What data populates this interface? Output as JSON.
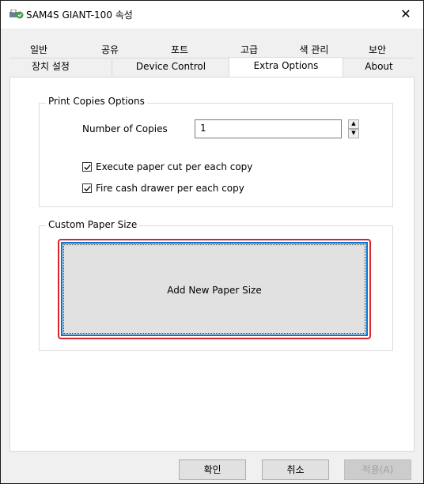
{
  "window": {
    "title": "SAM4S GIANT-100 속성",
    "close_glyph": "✕"
  },
  "tabs": {
    "row1": [
      "일반",
      "공유",
      "포트",
      "고급",
      "색 관리",
      "보안"
    ],
    "row2": [
      "장치 설정",
      "Device Control",
      "Extra Options",
      "About"
    ],
    "selected": "Extra Options"
  },
  "print_copies": {
    "group_title": "Print Copies Options",
    "number_label": "Number of Copies",
    "number_value": "1",
    "cut_label": "Execute paper cut per each copy",
    "cut_checked": true,
    "drawer_label": "Fire cash drawer per each copy",
    "drawer_checked": true
  },
  "custom_paper": {
    "group_title": "Custom Paper Size",
    "add_button": "Add New Paper Size"
  },
  "footer": {
    "ok": "확인",
    "cancel": "취소",
    "apply": "적용(A)"
  },
  "icons": {
    "app": "printer-icon",
    "close": "close-icon",
    "spin_up": "spin-up-icon",
    "spin_down": "spin-down-icon",
    "check": "checkmark-icon"
  },
  "colors": {
    "highlight_border": "#d9232e",
    "focus_border": "#0078d7"
  }
}
